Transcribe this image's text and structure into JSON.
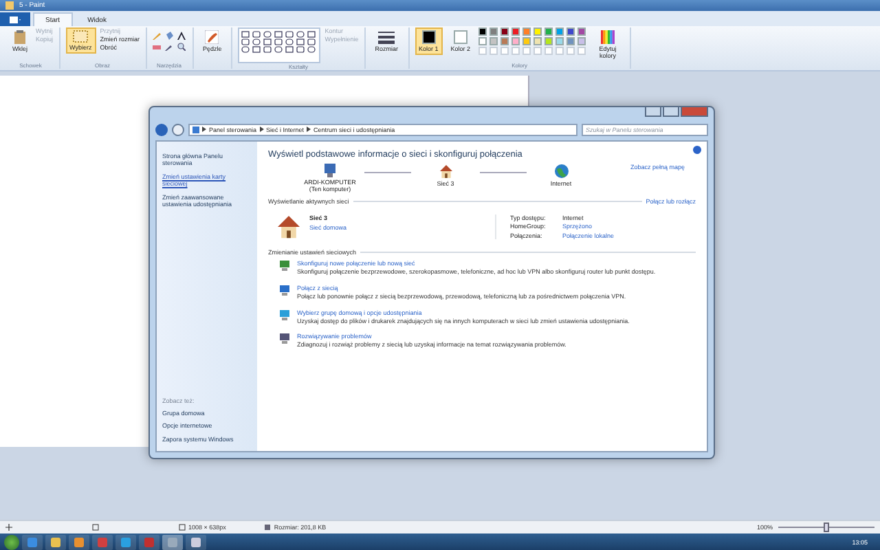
{
  "paint": {
    "title": "5 - Paint",
    "tabs": [
      {
        "label": "Start",
        "selected": true
      },
      {
        "label": "Widok",
        "selected": false
      }
    ],
    "groups": [
      {
        "kind": "clipboard",
        "label": "Schowek",
        "big": "Wklej",
        "small": [
          "Wytnij",
          "Kopiuj"
        ]
      },
      {
        "kind": "image",
        "label": "Obraz",
        "big": "Wybierz",
        "small": [
          "Przytnij",
          "Zmień rozmiar",
          "Obróć"
        ]
      },
      {
        "kind": "tools",
        "label": "Narzędzia"
      },
      {
        "kind": "brushes",
        "big": "Pędzle"
      },
      {
        "kind": "shapes",
        "label": "Kształty",
        "small": [
          "Kontur",
          "Wypełnienie"
        ]
      },
      {
        "kind": "size",
        "big": "Rozmiar"
      },
      {
        "kind": "colors",
        "label": "Kolory",
        "slots": [
          {
            "label": "Kolor 1",
            "color": "#000000",
            "selected": true
          },
          {
            "label": "Kolor 2",
            "color": "#ffffff",
            "selected": false
          }
        ],
        "palette": [
          {
            "color": "#000000"
          },
          {
            "color": "#7f7f7f"
          },
          {
            "color": "#880015"
          },
          {
            "color": "#ed1c24"
          },
          {
            "color": "#ff7f27"
          },
          {
            "color": "#fff200"
          },
          {
            "color": "#22b14c"
          },
          {
            "color": "#00a2e8"
          },
          {
            "color": "#3f48cc"
          },
          {
            "color": "#a349a4"
          },
          {
            "color": "#ffffff"
          },
          {
            "color": "#c3c3c3"
          },
          {
            "color": "#b97a57"
          },
          {
            "color": "#ffaec9"
          },
          {
            "color": "#ffc90e"
          },
          {
            "color": "#efe4b0"
          },
          {
            "color": "#b5e61d"
          },
          {
            "color": "#99d9ea"
          },
          {
            "color": "#7092be"
          },
          {
            "color": "#c8bfe7"
          }
        ],
        "edit": "Edytuj kolory"
      }
    ],
    "status": {
      "dimensions": "1008 × 638px",
      "size": "Rozmiar: 201,8 KB",
      "zoom": "100%",
      "level": 0.5
    }
  },
  "explorer": {
    "breadcrumb": [
      "Panel sterowania",
      "Sieć i Internet",
      "Centrum sieci i udostępniania"
    ],
    "search": {
      "placeholder": "Szukaj w Panelu sterowania"
    },
    "sidebar": {
      "links": [
        "Strona główna Panelu sterowania",
        "Zmień ustawienia karty sieciowej",
        "Zmień zaawansowane ustawienia udostępniania"
      ],
      "see_also_title": "Zobacz też:",
      "see_also": [
        "Grupa domowa",
        "Opcje internetowe",
        "Zapora systemu Windows"
      ]
    },
    "heading": "Wyświetl podstawowe informacje o sieci i skonfiguruj połączenia",
    "map_link": "Zobacz pełną mapę",
    "map": [
      {
        "kind": "computer",
        "name": "ARDI-KOMPUTER",
        "note": "(Ten komputer)"
      },
      {
        "kind": "house",
        "name": "Sieć 3"
      },
      {
        "kind": "globe",
        "name": "Internet"
      }
    ],
    "active_title": "Wyświetlanie aktywnych sieci",
    "connect_link": "Połącz lub rozłącz",
    "network": {
      "name": "Sieć 3",
      "type": "Sieć domowa",
      "props": [
        {
          "label": "Typ dostępu:",
          "value": "Internet",
          "link": false
        },
        {
          "label": "HomeGroup:",
          "value": "Sprzężono",
          "link": true
        },
        {
          "label": "Połączenia:",
          "value": "Połączenie lokalne",
          "link": true
        }
      ]
    },
    "change_title": "Zmienianie ustawień sieciowych",
    "tasks": [
      {
        "kind": "setup",
        "title": "Skonfiguruj nowe połączenie lub nową sieć",
        "desc": "Skonfiguruj połączenie bezprzewodowe, szerokopasmowe, telefoniczne, ad hoc lub VPN albo skonfiguruj router lub punkt dostępu."
      },
      {
        "kind": "connect",
        "title": "Połącz z siecią",
        "desc": "Połącz lub ponownie połącz z siecią bezprzewodową, przewodową, telefoniczną lub za pośrednictwem połączenia VPN."
      },
      {
        "kind": "homegroup",
        "title": "Wybierz grupę domową i opcje udostępniania",
        "desc": "Uzyskaj dostęp do plików i drukarek znajdujących się na innych komputerach w sieci lub zmień ustawienia udostępniania."
      },
      {
        "kind": "troubleshoot",
        "title": "Rozwiązywanie problemów",
        "desc": "Zdiagnozuj i rozwiąż problemy z siecią lub uzyskaj informacje na temat rozwiązywania problemów."
      }
    ]
  },
  "taskbar": {
    "clock": "13:05"
  }
}
